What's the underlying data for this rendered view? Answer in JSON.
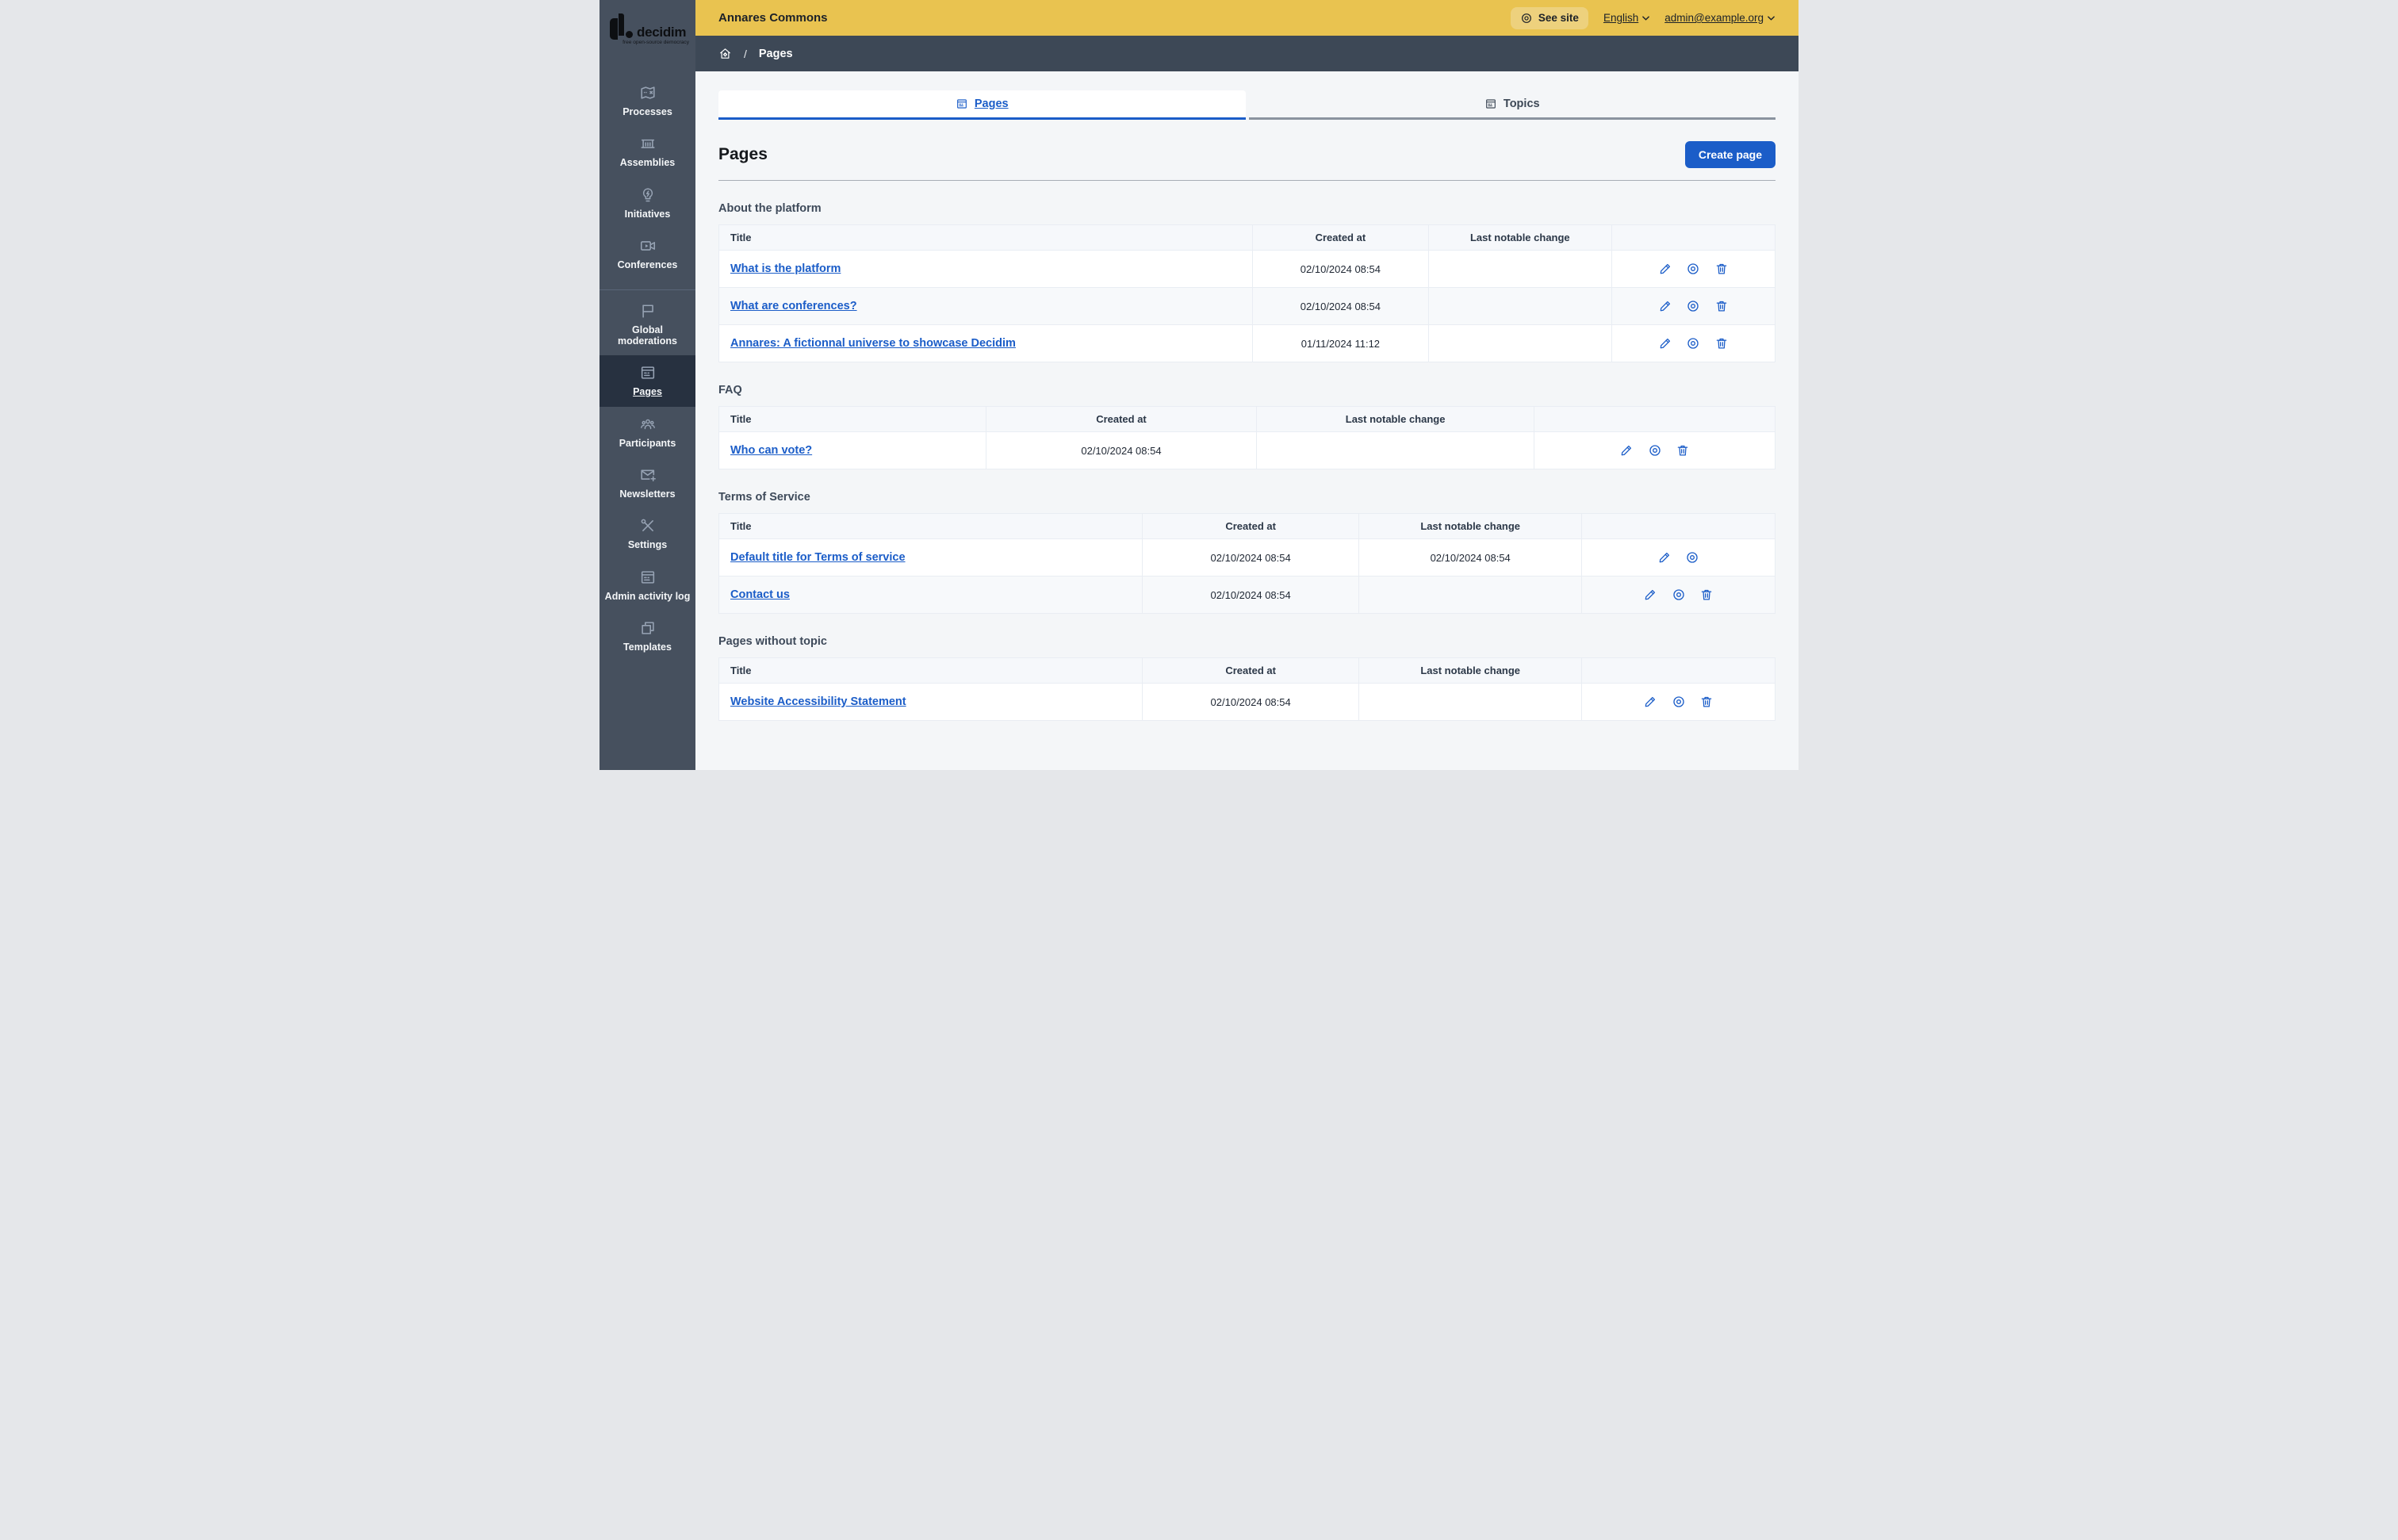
{
  "brand": {
    "logo_text": "decidim",
    "logo_tagline": "free open-source democracy"
  },
  "top_bar": {
    "site_name": "Annares Commons",
    "see_site": "See site",
    "language": "English",
    "account": "admin@example.org"
  },
  "breadcrumb": {
    "separator": "/",
    "current": "Pages"
  },
  "sidebar": {
    "main": [
      {
        "label": "Processes",
        "icon": "map-icon"
      },
      {
        "label": "Assemblies",
        "icon": "bank-icon"
      },
      {
        "label": "Initiatives",
        "icon": "lightbulb-icon"
      },
      {
        "label": "Conferences",
        "icon": "video-camera-icon"
      }
    ],
    "secondary": [
      {
        "label": "Global moderations",
        "icon": "flag-icon",
        "active": false
      },
      {
        "label": "Pages",
        "icon": "window-icon",
        "active": true
      },
      {
        "label": "Participants",
        "icon": "people-icon",
        "active": false
      },
      {
        "label": "Newsletters",
        "icon": "mail-add-icon",
        "active": false
      },
      {
        "label": "Settings",
        "icon": "tools-icon",
        "active": false
      },
      {
        "label": "Admin activity log",
        "icon": "window-icon",
        "active": false
      },
      {
        "label": "Templates",
        "icon": "copy-icon",
        "active": false
      }
    ]
  },
  "tabs": {
    "pages": "Pages",
    "topics": "Topics"
  },
  "page": {
    "title": "Pages",
    "create_button": "Create page"
  },
  "table_columns": {
    "title": "Title",
    "created_at": "Created at",
    "last_change": "Last notable change"
  },
  "action_icons": [
    "pencil-icon",
    "preview-eye-icon",
    "trash-icon"
  ],
  "sections": [
    {
      "heading": "About the platform",
      "rows": [
        {
          "title": "What is the platform",
          "created_at": "02/10/2024 08:54",
          "last_change": "",
          "actions": [
            "edit",
            "preview",
            "delete"
          ]
        },
        {
          "title": "What are conferences?",
          "created_at": "02/10/2024 08:54",
          "last_change": "",
          "actions": [
            "edit",
            "preview",
            "delete"
          ]
        },
        {
          "title": "Annares: A fictionnal universe to showcase Decidim",
          "created_at": "01/11/2024 11:12",
          "last_change": "",
          "actions": [
            "edit",
            "preview",
            "delete"
          ]
        }
      ]
    },
    {
      "heading": "FAQ",
      "rows": [
        {
          "title": "Who can vote?",
          "created_at": "02/10/2024 08:54",
          "last_change": "",
          "actions": [
            "edit",
            "preview",
            "delete"
          ]
        }
      ]
    },
    {
      "heading": "Terms of Service",
      "rows": [
        {
          "title": "Default title for Terms of service",
          "created_at": "02/10/2024 08:54",
          "last_change": "02/10/2024 08:54",
          "actions": [
            "edit",
            "preview"
          ]
        },
        {
          "title": "Contact us",
          "created_at": "02/10/2024 08:54",
          "last_change": "",
          "actions": [
            "edit",
            "preview",
            "delete"
          ]
        }
      ]
    },
    {
      "heading": "Pages without topic",
      "rows": [
        {
          "title": "Website Accessibility Statement",
          "created_at": "02/10/2024 08:54",
          "last_change": "",
          "actions": [
            "edit",
            "preview",
            "delete"
          ]
        }
      ]
    }
  ],
  "colors": {
    "topbar_yellow": "#e9c350",
    "see_site_pill": "#edd17d",
    "sidebar_slate": "#46505e",
    "sidebar_active": "#273140",
    "breadcrumb_slate": "#3d4856",
    "link_blue": "#1b5dc8",
    "page_bg": "#f4f6f8",
    "table_header_bg": "#f6f8fb",
    "row_stripe_bg": "#f7f9fb"
  }
}
